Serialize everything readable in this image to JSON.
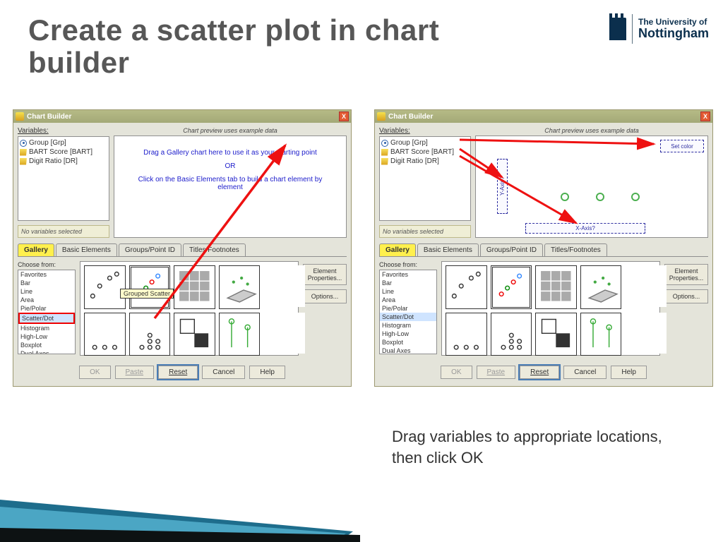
{
  "slide": {
    "title": "Create a scatter plot in chart builder",
    "caption": "Drag variables to appropriate locations, then click OK"
  },
  "university": {
    "prefix": "The University of",
    "name": "Nottingham"
  },
  "dialog": {
    "title": "Chart Builder",
    "variables_label": "Variables:",
    "variables": [
      "Group [Grp]",
      "BART Score [BART]",
      "Digit Ratio [DR]"
    ],
    "no_selection": "No variables selected",
    "preview_header": "Chart preview uses example data",
    "preview_line1": "Drag a Gallery chart here to use it as your starting point",
    "preview_or": "OR",
    "preview_line2": "Click on the Basic Elements tab to build a chart element by element",
    "tabs": [
      "Gallery",
      "Basic Elements",
      "Groups/Point ID",
      "Titles/Footnotes"
    ],
    "choose_from": "Choose from:",
    "types": [
      "Favorites",
      "Bar",
      "Line",
      "Area",
      "Pie/Polar",
      "Scatter/Dot",
      "Histogram",
      "High-Low",
      "Boxplot",
      "Dual Axes"
    ],
    "side_buttons": {
      "props": "Element Properties...",
      "options": "Options..."
    },
    "buttons": {
      "ok": "OK",
      "paste": "Paste",
      "reset": "Reset",
      "cancel": "Cancel",
      "help": "Help"
    },
    "tooltip": "Grouped Scatter",
    "drop_setcolor": "Set color",
    "drop_yaxis": "Y-Axis?",
    "drop_xaxis": "X-Axis?"
  }
}
